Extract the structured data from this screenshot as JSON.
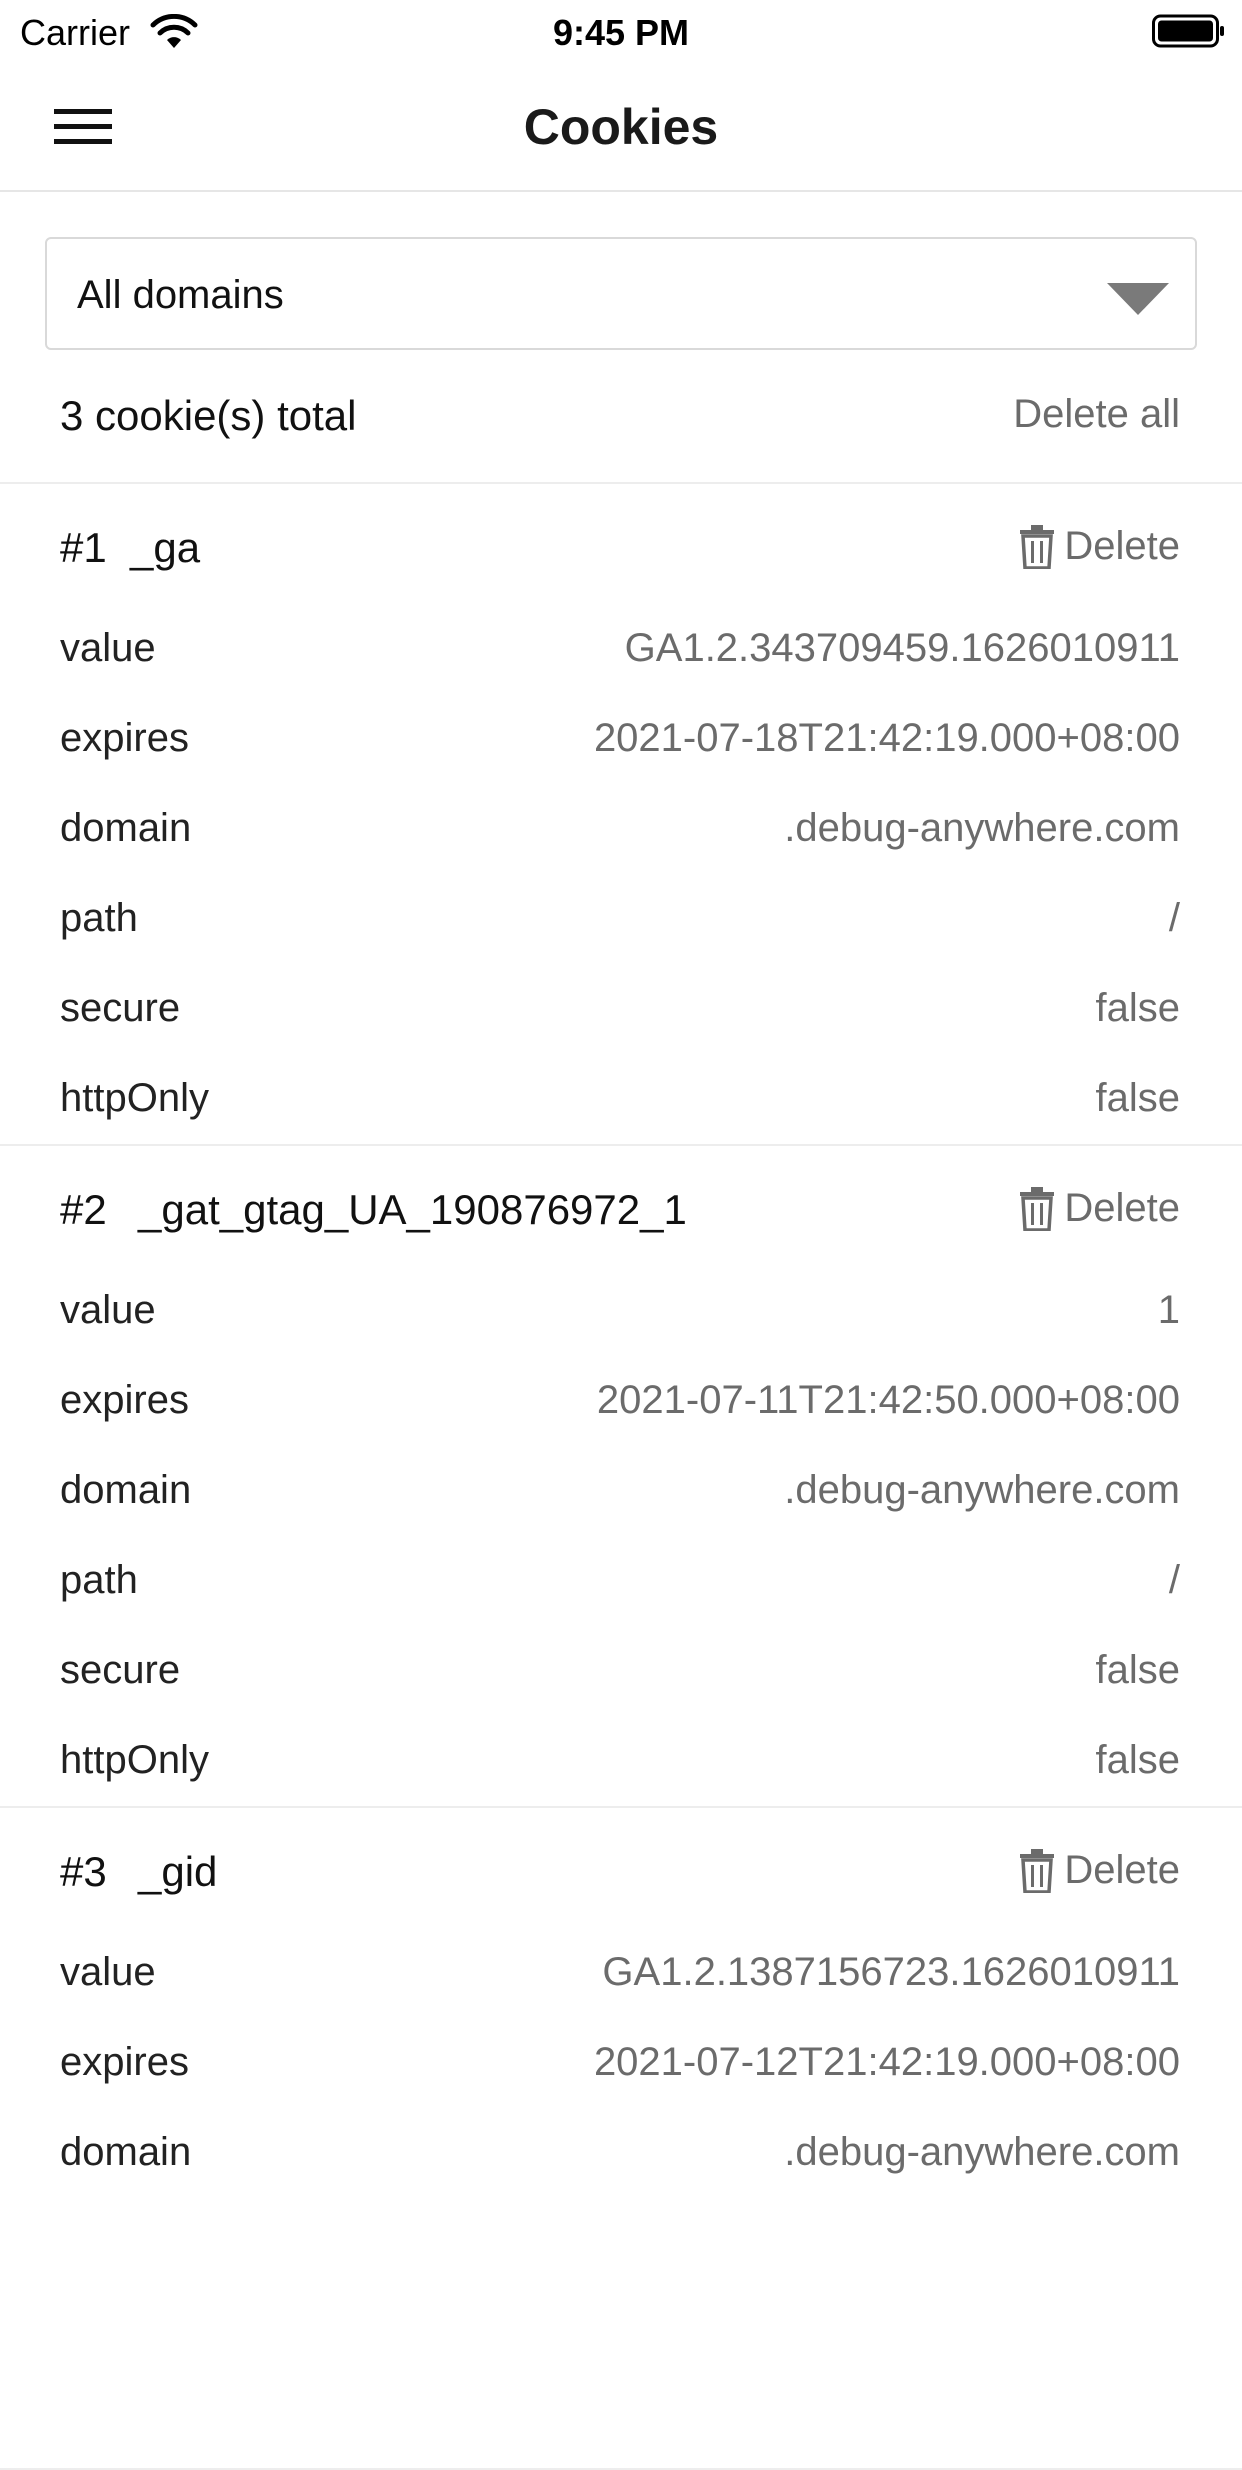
{
  "status_bar": {
    "carrier": "Carrier",
    "time": "9:45 PM"
  },
  "nav": {
    "title": "Cookies"
  },
  "filter": {
    "selected": "All domains"
  },
  "summary": {
    "count_text": "3 cookie(s) total",
    "delete_all_label": "Delete all"
  },
  "delete_label": "Delete",
  "cookies": [
    {
      "index": "#1",
      "name": "_ga",
      "fields": [
        {
          "label": "value",
          "value": "GA1.2.343709459.1626010911"
        },
        {
          "label": "expires",
          "value": "2021-07-18T21:42:19.000+08:00"
        },
        {
          "label": "domain",
          "value": ".debug-anywhere.com"
        },
        {
          "label": "path",
          "value": "/"
        },
        {
          "label": "secure",
          "value": "false"
        },
        {
          "label": "httpOnly",
          "value": "false"
        }
      ]
    },
    {
      "index": "#2",
      "name": "_gat_gtag_UA_190876972_1",
      "fields": [
        {
          "label": "value",
          "value": "1"
        },
        {
          "label": "expires",
          "value": "2021-07-11T21:42:50.000+08:00"
        },
        {
          "label": "domain",
          "value": ".debug-anywhere.com"
        },
        {
          "label": "path",
          "value": "/"
        },
        {
          "label": "secure",
          "value": "false"
        },
        {
          "label": "httpOnly",
          "value": "false"
        }
      ]
    },
    {
      "index": "#3",
      "name": "_gid",
      "fields": [
        {
          "label": "value",
          "value": "GA1.2.1387156723.1626010911"
        },
        {
          "label": "expires",
          "value": "2021-07-12T21:42:19.000+08:00"
        },
        {
          "label": "domain",
          "value": ".debug-anywhere.com"
        }
      ]
    }
  ]
}
